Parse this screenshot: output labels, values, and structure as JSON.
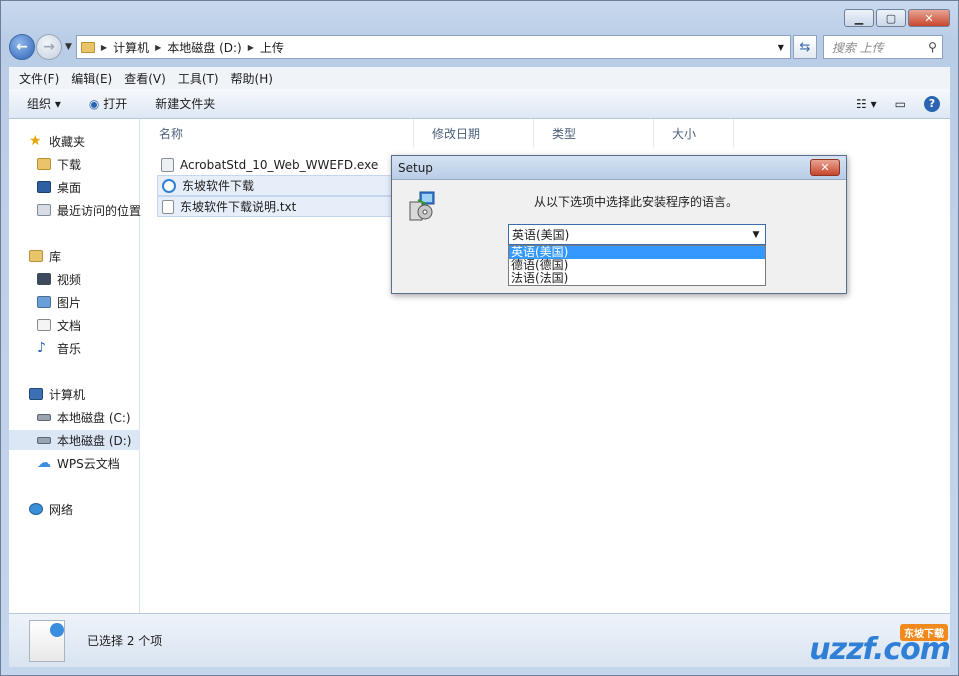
{
  "navigation": {
    "back_icon": "back-arrow-icon",
    "forward_icon": "forward-arrow-icon"
  },
  "address": {
    "crumbs": [
      "计算机",
      "本地磁盘 (D:)",
      "上传"
    ]
  },
  "search": {
    "placeholder": "搜索 上传"
  },
  "menubar": [
    "文件(F)",
    "编辑(E)",
    "查看(V)",
    "工具(T)",
    "帮助(H)"
  ],
  "toolbar": {
    "organize": "组织",
    "open": "打开",
    "new_folder": "新建文件夹"
  },
  "sidebar": {
    "favorites": "收藏夹",
    "favorites_items": [
      "下载",
      "桌面",
      "最近访问的位置"
    ],
    "libraries": "库",
    "library_items": [
      "视频",
      "图片",
      "文档",
      "音乐"
    ],
    "computer": "计算机",
    "computer_items": [
      "本地磁盘 (C:)",
      "本地磁盘 (D:)",
      "WPS云文档"
    ],
    "network": "网络"
  },
  "columns": [
    "名称",
    "修改日期",
    "类型",
    "大小"
  ],
  "files": [
    {
      "name": "AcrobatStd_10_Web_WWEFD.exe",
      "icon": "exe-icon"
    },
    {
      "name": "东坡软件下载",
      "icon": "ie-link-icon"
    },
    {
      "name": "东坡软件下载说明.txt",
      "icon": "text-file-icon"
    }
  ],
  "status": {
    "text": "已选择 2 个项"
  },
  "watermark": {
    "text": "uzzf.com",
    "badge": "东坡下载"
  },
  "dialog": {
    "title": "Setup",
    "message": "从以下选项中选择此安装程序的语言。",
    "selected": "英语(美国)",
    "options": [
      "英语(美国)",
      "德语(德国)",
      "法语(法国)"
    ]
  }
}
